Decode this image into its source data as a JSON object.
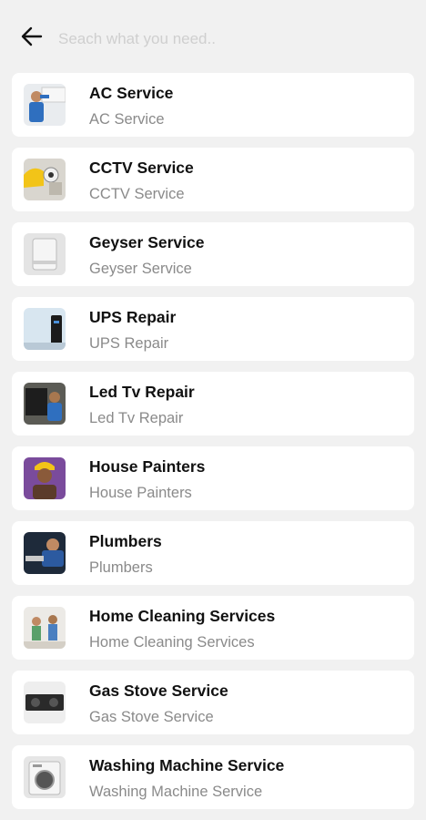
{
  "search": {
    "placeholder": "Seach what you need.."
  },
  "services": [
    {
      "title": "AC Service",
      "subtitle": "AC Service",
      "icon": "ac-service-photo"
    },
    {
      "title": "CCTV Service",
      "subtitle": "CCTV Service",
      "icon": "cctv-service-photo"
    },
    {
      "title": "Geyser Service",
      "subtitle": "Geyser Service",
      "icon": "geyser-service-photo"
    },
    {
      "title": "UPS Repair",
      "subtitle": "UPS Repair",
      "icon": "ups-repair-photo"
    },
    {
      "title": "Led Tv Repair",
      "subtitle": "Led Tv Repair",
      "icon": "led-tv-repair-photo"
    },
    {
      "title": "House Painters",
      "subtitle": "House Painters",
      "icon": "house-painters-photo"
    },
    {
      "title": "Plumbers",
      "subtitle": "Plumbers",
      "icon": "plumbers-photo"
    },
    {
      "title": "Home Cleaning Services",
      "subtitle": "Home Cleaning Services",
      "icon": "home-cleaning-photo"
    },
    {
      "title": "Gas Stove Service",
      "subtitle": "Gas Stove Service",
      "icon": "gas-stove-photo"
    },
    {
      "title": "Washing Machine Service",
      "subtitle": "Washing Machine Service",
      "icon": "washing-machine-photo"
    }
  ]
}
